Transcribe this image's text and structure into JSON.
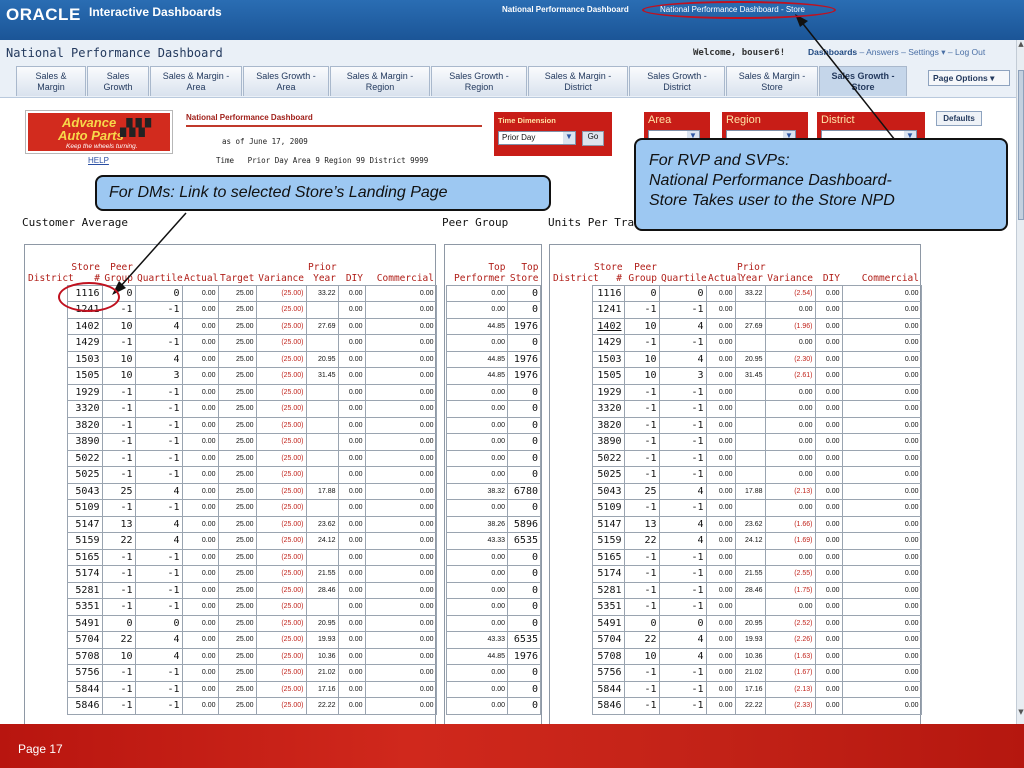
{
  "topbar": {
    "brand": "ORACLE",
    "app_name": "Interactive Dashboards",
    "dashboard_label": "National Performance Dashboard",
    "page_selector": "National Performance Dashboard - Store"
  },
  "header": {
    "title": "National Performance Dashboard",
    "welcome": "Welcome, bouser6!",
    "links": [
      "Dashboards",
      "Answers",
      "Settings",
      "Log Out"
    ],
    "page_options": "Page Options"
  },
  "tabs": [
    {
      "label": "Sales & Margin",
      "width": 70
    },
    {
      "label": "Sales Growth",
      "width": 62
    },
    {
      "label": "Sales & Margin - Area",
      "width": 92
    },
    {
      "label": "Sales Growth - Area",
      "width": 86
    },
    {
      "label": "Sales & Margin - Region",
      "width": 100
    },
    {
      "label": "Sales Growth - Region",
      "width": 96
    },
    {
      "label": "Sales & Margin - District",
      "width": 100
    },
    {
      "label": "Sales Growth - District",
      "width": 96
    },
    {
      "label": "Sales & Margin - Store",
      "width": 92
    },
    {
      "label": "Sales Growth - Store",
      "width": 88
    }
  ],
  "active_tab": 9,
  "dashboard": {
    "logo_line1": "Advance",
    "logo_line2": "Auto Parts",
    "logo_tagline": "Keep the wheels turning.",
    "help": "HELP",
    "npd_title": "National Performance Dashboard",
    "as_of": "as of June 17, 2009",
    "time_line": "Time   Prior Day Area 9 Region 99 District 9999",
    "time_dimension_label": "Time Dimension",
    "time_dimension_value": "Prior Day",
    "go": "Go",
    "area_label": "Area",
    "region_label": "Region",
    "district_label": "District",
    "defaults": "Defaults"
  },
  "sections": {
    "customer_average": "Customer Average",
    "peer_group": "Peer Group",
    "units_per_tran": "Units Per Tran"
  },
  "customer_table": {
    "headers": [
      "District",
      "Store #",
      "Peer Group",
      "Quartile",
      "Actual",
      "Target",
      "Variance",
      "Prior Year",
      "DIY",
      "Commercial"
    ],
    "rows": [
      [
        "",
        "1116",
        "0",
        "0",
        "0.00",
        "25.00",
        "(25.00)",
        "33.22",
        "0.00",
        "0.00"
      ],
      [
        "",
        "1241",
        "-1",
        "-1",
        "0.00",
        "25.00",
        "(25.00)",
        "",
        "0.00",
        "0.00"
      ],
      [
        "",
        "1402",
        "10",
        "4",
        "0.00",
        "25.00",
        "(25.00)",
        "27.69",
        "0.00",
        "0.00"
      ],
      [
        "",
        "1429",
        "-1",
        "-1",
        "0.00",
        "25.00",
        "(25.00)",
        "",
        "0.00",
        "0.00"
      ],
      [
        "",
        "1503",
        "10",
        "4",
        "0.00",
        "25.00",
        "(25.00)",
        "20.95",
        "0.00",
        "0.00"
      ],
      [
        "",
        "1505",
        "10",
        "3",
        "0.00",
        "25.00",
        "(25.00)",
        "31.45",
        "0.00",
        "0.00"
      ],
      [
        "",
        "1929",
        "-1",
        "-1",
        "0.00",
        "25.00",
        "(25.00)",
        "",
        "0.00",
        "0.00"
      ],
      [
        "",
        "3320",
        "-1",
        "-1",
        "0.00",
        "25.00",
        "(25.00)",
        "",
        "0.00",
        "0.00"
      ],
      [
        "",
        "3820",
        "-1",
        "-1",
        "0.00",
        "25.00",
        "(25.00)",
        "",
        "0.00",
        "0.00"
      ],
      [
        "",
        "3890",
        "-1",
        "-1",
        "0.00",
        "25.00",
        "(25.00)",
        "",
        "0.00",
        "0.00"
      ],
      [
        "",
        "5022",
        "-1",
        "-1",
        "0.00",
        "25.00",
        "(25.00)",
        "",
        "0.00",
        "0.00"
      ],
      [
        "",
        "5025",
        "-1",
        "-1",
        "0.00",
        "25.00",
        "(25.00)",
        "",
        "0.00",
        "0.00"
      ],
      [
        "",
        "5043",
        "25",
        "4",
        "0.00",
        "25.00",
        "(25.00)",
        "17.88",
        "0.00",
        "0.00"
      ],
      [
        "",
        "5109",
        "-1",
        "-1",
        "0.00",
        "25.00",
        "(25.00)",
        "",
        "0.00",
        "0.00"
      ],
      [
        "",
        "5147",
        "13",
        "4",
        "0.00",
        "25.00",
        "(25.00)",
        "23.62",
        "0.00",
        "0.00"
      ],
      [
        "",
        "5159",
        "22",
        "4",
        "0.00",
        "25.00",
        "(25.00)",
        "24.12",
        "0.00",
        "0.00"
      ],
      [
        "",
        "5165",
        "-1",
        "-1",
        "0.00",
        "25.00",
        "(25.00)",
        "",
        "0.00",
        "0.00"
      ],
      [
        "",
        "5174",
        "-1",
        "-1",
        "0.00",
        "25.00",
        "(25.00)",
        "21.55",
        "0.00",
        "0.00"
      ],
      [
        "",
        "5281",
        "-1",
        "-1",
        "0.00",
        "25.00",
        "(25.00)",
        "28.46",
        "0.00",
        "0.00"
      ],
      [
        "",
        "5351",
        "-1",
        "-1",
        "0.00",
        "25.00",
        "(25.00)",
        "",
        "0.00",
        "0.00"
      ],
      [
        "",
        "5491",
        "0",
        "0",
        "0.00",
        "25.00",
        "(25.00)",
        "20.95",
        "0.00",
        "0.00"
      ],
      [
        "",
        "5704",
        "22",
        "4",
        "0.00",
        "25.00",
        "(25.00)",
        "19.93",
        "0.00",
        "0.00"
      ],
      [
        "",
        "5708",
        "10",
        "4",
        "0.00",
        "25.00",
        "(25.00)",
        "10.36",
        "0.00",
        "0.00"
      ],
      [
        "",
        "5756",
        "-1",
        "-1",
        "0.00",
        "25.00",
        "(25.00)",
        "21.02",
        "0.00",
        "0.00"
      ],
      [
        "",
        "5844",
        "-1",
        "-1",
        "0.00",
        "25.00",
        "(25.00)",
        "17.16",
        "0.00",
        "0.00"
      ],
      [
        "",
        "5846",
        "-1",
        "-1",
        "0.00",
        "25.00",
        "(25.00)",
        "22.22",
        "0.00",
        "0.00"
      ]
    ]
  },
  "peer_table": {
    "headers": [
      "Top Performer",
      "Top Store"
    ],
    "rows": [
      [
        "0.00",
        "0"
      ],
      [
        "0.00",
        "0"
      ],
      [
        "44.85",
        "1976"
      ],
      [
        "0.00",
        "0"
      ],
      [
        "44.85",
        "1976"
      ],
      [
        "44.85",
        "1976"
      ],
      [
        "0.00",
        "0"
      ],
      [
        "0.00",
        "0"
      ],
      [
        "0.00",
        "0"
      ],
      [
        "0.00",
        "0"
      ],
      [
        "0.00",
        "0"
      ],
      [
        "0.00",
        "0"
      ],
      [
        "38.32",
        "6780"
      ],
      [
        "0.00",
        "0"
      ],
      [
        "38.26",
        "5896"
      ],
      [
        "43.33",
        "6535"
      ],
      [
        "0.00",
        "0"
      ],
      [
        "0.00",
        "0"
      ],
      [
        "0.00",
        "0"
      ],
      [
        "0.00",
        "0"
      ],
      [
        "0.00",
        "0"
      ],
      [
        "43.33",
        "6535"
      ],
      [
        "44.85",
        "1976"
      ],
      [
        "0.00",
        "0"
      ],
      [
        "0.00",
        "0"
      ],
      [
        "0.00",
        "0"
      ]
    ]
  },
  "units_table": {
    "headers": [
      "District",
      "Store #",
      "Peer Group",
      "Quartile",
      "Actual",
      "Prior Year",
      "Variance",
      "DIY",
      "Commercial"
    ],
    "rows": [
      [
        "",
        "1116",
        "0",
        "0",
        "0.00",
        "33.22",
        "(2.54)",
        "0.00",
        "0.00"
      ],
      [
        "",
        "1241",
        "-1",
        "-1",
        "0.00",
        "",
        "0.00",
        "0.00",
        "0.00"
      ],
      [
        "",
        "1402",
        "10",
        "4",
        "0.00",
        "27.69",
        "(1.96)",
        "0.00",
        "0.00"
      ],
      [
        "",
        "1429",
        "-1",
        "-1",
        "0.00",
        "",
        "0.00",
        "0.00",
        "0.00"
      ],
      [
        "",
        "1503",
        "10",
        "4",
        "0.00",
        "20.95",
        "(2.30)",
        "0.00",
        "0.00"
      ],
      [
        "",
        "1505",
        "10",
        "3",
        "0.00",
        "31.45",
        "(2.61)",
        "0.00",
        "0.00"
      ],
      [
        "",
        "1929",
        "-1",
        "-1",
        "0.00",
        "",
        "0.00",
        "0.00",
        "0.00"
      ],
      [
        "",
        "3320",
        "-1",
        "-1",
        "0.00",
        "",
        "0.00",
        "0.00",
        "0.00"
      ],
      [
        "",
        "3820",
        "-1",
        "-1",
        "0.00",
        "",
        "0.00",
        "0.00",
        "0.00"
      ],
      [
        "",
        "3890",
        "-1",
        "-1",
        "0.00",
        "",
        "0.00",
        "0.00",
        "0.00"
      ],
      [
        "",
        "5022",
        "-1",
        "-1",
        "0.00",
        "",
        "0.00",
        "0.00",
        "0.00"
      ],
      [
        "",
        "5025",
        "-1",
        "-1",
        "0.00",
        "",
        "0.00",
        "0.00",
        "0.00"
      ],
      [
        "",
        "5043",
        "25",
        "4",
        "0.00",
        "17.88",
        "(2.13)",
        "0.00",
        "0.00"
      ],
      [
        "",
        "5109",
        "-1",
        "-1",
        "0.00",
        "",
        "0.00",
        "0.00",
        "0.00"
      ],
      [
        "",
        "5147",
        "13",
        "4",
        "0.00",
        "23.62",
        "(1.66)",
        "0.00",
        "0.00"
      ],
      [
        "",
        "5159",
        "22",
        "4",
        "0.00",
        "24.12",
        "(1.69)",
        "0.00",
        "0.00"
      ],
      [
        "",
        "5165",
        "-1",
        "-1",
        "0.00",
        "",
        "0.00",
        "0.00",
        "0.00"
      ],
      [
        "",
        "5174",
        "-1",
        "-1",
        "0.00",
        "21.55",
        "(2.55)",
        "0.00",
        "0.00"
      ],
      [
        "",
        "5281",
        "-1",
        "-1",
        "0.00",
        "28.46",
        "(1.75)",
        "0.00",
        "0.00"
      ],
      [
        "",
        "5351",
        "-1",
        "-1",
        "0.00",
        "",
        "0.00",
        "0.00",
        "0.00"
      ],
      [
        "",
        "5491",
        "0",
        "0",
        "0.00",
        "20.95",
        "(2.52)",
        "0.00",
        "0.00"
      ],
      [
        "",
        "5704",
        "22",
        "4",
        "0.00",
        "19.93",
        "(2.26)",
        "0.00",
        "0.00"
      ],
      [
        "",
        "5708",
        "10",
        "4",
        "0.00",
        "10.36",
        "(1.63)",
        "0.00",
        "0.00"
      ],
      [
        "",
        "5756",
        "-1",
        "-1",
        "0.00",
        "21.02",
        "(1.67)",
        "0.00",
        "0.00"
      ],
      [
        "",
        "5844",
        "-1",
        "-1",
        "0.00",
        "17.16",
        "(2.13)",
        "0.00",
        "0.00"
      ],
      [
        "",
        "5846",
        "-1",
        "-1",
        "0.00",
        "22.22",
        "(2.33)",
        "0.00",
        "0.00"
      ]
    ]
  },
  "callouts": {
    "dm": "For DMs:  Link to  selected Store’s  Landing Page",
    "rvp_line1": "For RVP and SVPs:",
    "rvp_line2": "National Performance Dashboard-",
    "rvp_line3": "Store Takes user to the Store NPD"
  },
  "footer": {
    "page": "Page 17"
  },
  "colors": {
    "accent_red": "#c0241c",
    "header_blue": "#1b5597",
    "callout_blue": "#9dc8f2"
  }
}
